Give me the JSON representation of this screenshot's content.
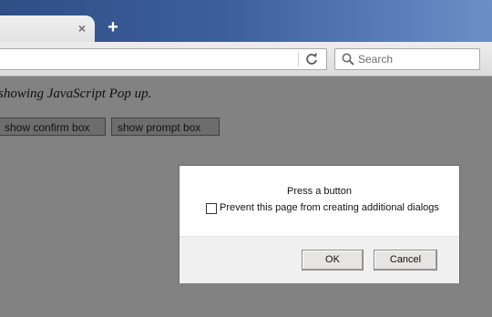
{
  "browser": {
    "tab": {
      "close_glyph": "×"
    },
    "new_tab_glyph": "+",
    "toolbar": {
      "url_value": "",
      "reload_icon": "reload-icon",
      "search_placeholder": "Search",
      "search_icon": "search-icon"
    }
  },
  "page": {
    "heading": "showing JavaScript Pop up.",
    "buttons": {
      "confirm_label": "show confirm box",
      "prompt_label": "show prompt box"
    }
  },
  "dialog": {
    "message": "Press a button",
    "checkbox_label": "Prevent this page from creating additional dialogs",
    "checkbox_checked": false,
    "ok_label": "OK",
    "cancel_label": "Cancel"
  },
  "colors": {
    "tabstrip": "#3c5f9b",
    "overlay": "#828282",
    "dialog_footer": "#f0f0f0"
  }
}
